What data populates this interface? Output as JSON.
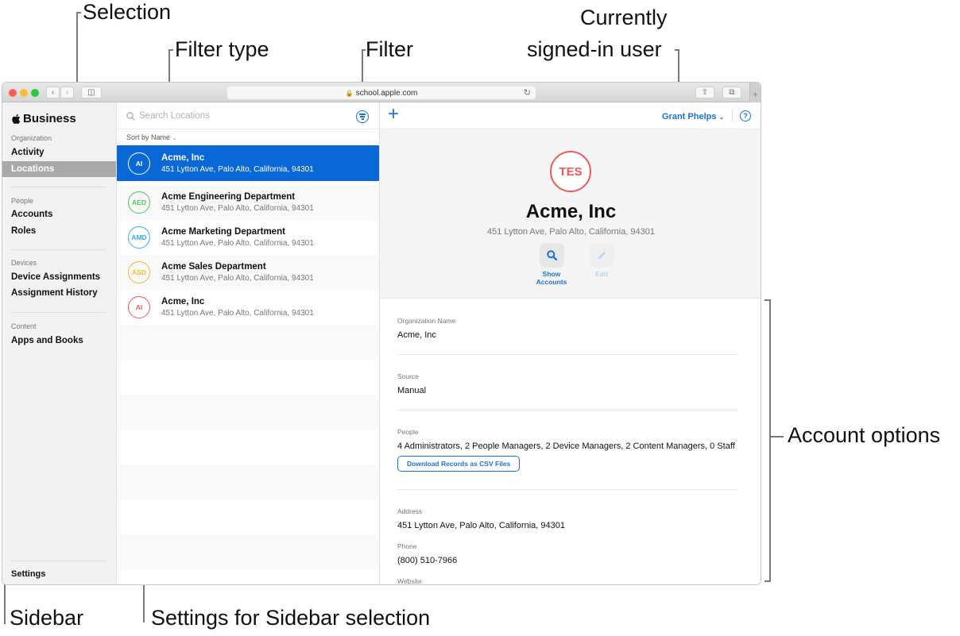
{
  "callouts": {
    "selection": "Selection",
    "filter_type": "Filter type",
    "filter": "Filter",
    "current_user_line1": "Currently",
    "current_user_line2": "signed-in user",
    "account_options": "Account options",
    "sidebar": "Sidebar",
    "settings": "Settings for Sidebar selection"
  },
  "browser": {
    "url": "school.apple.com",
    "lock_icon": "lock-icon",
    "back_icon": "chevron-left-icon",
    "forward_icon": "chevron-right-icon",
    "sidebar_icon": "sidebar-icon",
    "reload_icon": "reload-icon",
    "share_icon": "share-icon",
    "tabs_icon": "tabs-icon",
    "new_tab": "+"
  },
  "sidebar": {
    "brand": "Business",
    "sections": [
      {
        "title": "Organization",
        "items": [
          "Activity",
          "Locations"
        ]
      },
      {
        "title": "People",
        "items": [
          "Accounts",
          "Roles"
        ]
      },
      {
        "title": "Devices",
        "items": [
          "Device Assignments",
          "Assignment History"
        ]
      },
      {
        "title": "Content",
        "items": [
          "Apps and Books"
        ]
      }
    ],
    "selected": "Locations",
    "settings": "Settings"
  },
  "list": {
    "search_placeholder": "Search Locations",
    "sort_label": "Sort by Name",
    "rows": [
      {
        "initials": "AI",
        "name": "Acme, Inc",
        "address": "451 Lytton Ave, Palo Alto, California, 94301",
        "color": "#ffffff",
        "selected": true
      },
      {
        "initials": "AED",
        "name": "Acme Engineering Department",
        "address": "451 Lytton Ave, Palo Alto, California, 94301",
        "color": "#4cc35e"
      },
      {
        "initials": "AMD",
        "name": "Acme Marketing Department",
        "address": "451 Lytton Ave, Palo Alto, California, 94301",
        "color": "#34aee8"
      },
      {
        "initials": "ASD",
        "name": "Acme Sales Department",
        "address": "451 Lytton Ave, Palo Alto, California, 94301",
        "color": "#f7b731"
      },
      {
        "initials": "AI",
        "name": "Acme, Inc",
        "address": "451 Lytton Ave, Palo Alto, California, 94301",
        "color": "#ee5a5a"
      }
    ]
  },
  "detail": {
    "add_label": "+",
    "user_name": "Grant Phelps",
    "help_label": "?",
    "avatar_initials": "TES",
    "avatar_color": "#ee5a5a",
    "title": "Acme, Inc",
    "address": "451 Lytton Ave, Palo Alto, California, 94301",
    "actions": [
      {
        "label_line1": "Show",
        "label_line2": "Accounts",
        "enabled": true
      },
      {
        "label_line1": "Edit",
        "label_line2": "",
        "enabled": false
      }
    ],
    "fields": {
      "org_name_label": "Organization Name",
      "org_name": "Acme, Inc",
      "source_label": "Source",
      "source": "Manual",
      "people_label": "People",
      "people": "4 Administrators, 2 People Managers, 2 Device Managers, 2 Content Managers, 0 Staff",
      "csv_button": "Download Records as CSV Files",
      "address_label": "Address",
      "address": "451 Lytton Ave, Palo Alto, California, 94301",
      "phone_label": "Phone",
      "phone": "(800) 510-7966",
      "website_label": "Website"
    }
  },
  "colors": {
    "accent": "#1a73d9",
    "selection": "#0a68d6",
    "sidebar_selection": "#a9a9a9"
  }
}
